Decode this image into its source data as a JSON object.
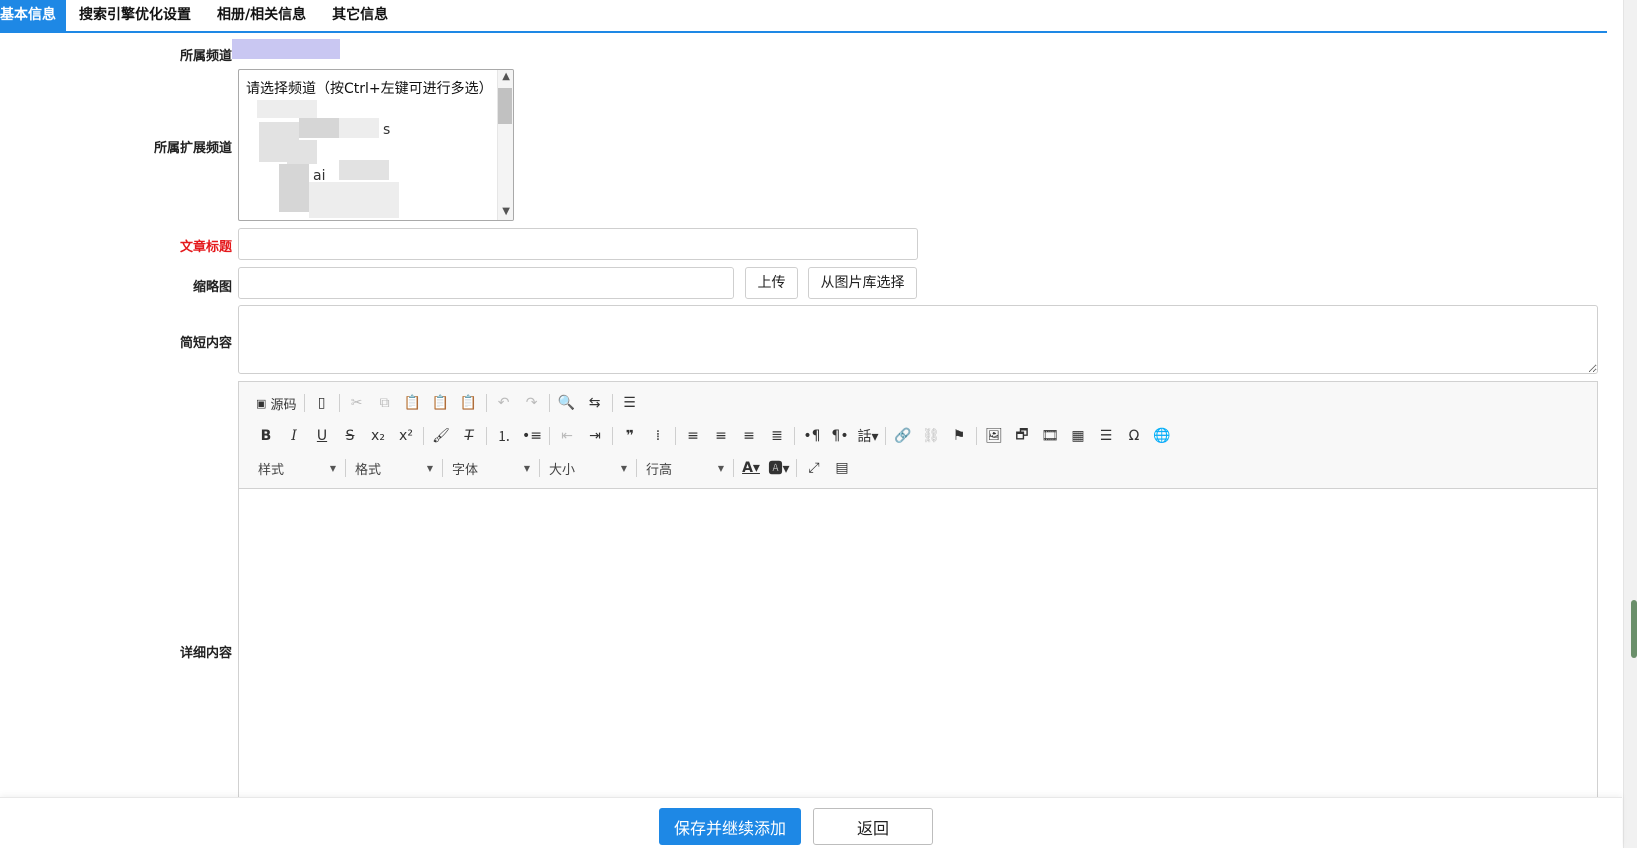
{
  "tabs": [
    {
      "label": "基本信息",
      "active": true
    },
    {
      "label": "搜索引擎优化设置",
      "active": false
    },
    {
      "label": "相册/相关信息",
      "active": false
    },
    {
      "label": "其它信息",
      "active": false
    }
  ],
  "form": {
    "channel_label": "所属频道",
    "ext_channel_label": "所属扩展频道",
    "ext_channel_placeholder_option": "请选择频道（按Ctrl+左键可进行多选）",
    "ext_channel_fragments": [
      "s",
      "ai"
    ],
    "title_label": "文章标题",
    "thumb_label": "缩略图",
    "upload_label": "上传",
    "library_label": "从图片库选择",
    "summary_label": "简短内容",
    "detail_label": "详细内容"
  },
  "editor": {
    "source_label": "源码",
    "combos": [
      "样式",
      "格式",
      "字体",
      "大小",
      "行高"
    ]
  },
  "footer": {
    "save_label": "保存并继续添加",
    "back_label": "返回"
  },
  "colors": {
    "accent": "#1e88e5",
    "required": "#e4191c"
  }
}
